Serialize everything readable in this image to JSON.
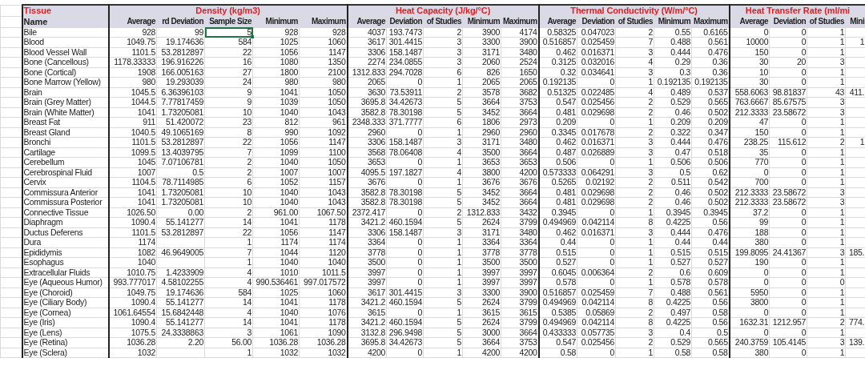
{
  "corner_header": "Tissue",
  "name_header": "Name",
  "groups": [
    {
      "title": "Density (kg/m3)",
      "columns": [
        {
          "label": "Average",
          "selected": false
        },
        {
          "label": "rd Deviation",
          "selected": false
        },
        {
          "label": "Sample Size",
          "selected": true
        },
        {
          "label": "Minimum",
          "selected": false
        },
        {
          "label": "Maximum",
          "selected": false
        }
      ]
    },
    {
      "title": "Heat Capacity (J/kg/°C)",
      "columns": [
        {
          "label": "Average",
          "selected": false
        },
        {
          "label": "Deviation",
          "selected": false
        },
        {
          "label": "of Studies",
          "selected": false
        },
        {
          "label": "Minimum",
          "selected": false
        },
        {
          "label": "Maximum",
          "selected": false
        }
      ]
    },
    {
      "title": "Thermal Conductivity (W/m/°C)",
      "columns": [
        {
          "label": "Average",
          "selected": false
        },
        {
          "label": "Deviation",
          "selected": false
        },
        {
          "label": "of Studies",
          "selected": false
        },
        {
          "label": "Minimum",
          "selected": false
        },
        {
          "label": "Maximum",
          "selected": false
        }
      ]
    },
    {
      "title": "Heat Transfer Rate (ml/mi",
      "columns": [
        {
          "label": "Average",
          "selected": false
        },
        {
          "label": "Deviation",
          "selected": false
        },
        {
          "label": "of Studies",
          "selected": false
        },
        {
          "label": "Mini",
          "selected": false
        }
      ]
    }
  ],
  "rows": [
    {
      "name": "Bile",
      "selected": true,
      "density": {
        "average": "928",
        "deviation": "99",
        "sample_size": "5",
        "minimum": "928",
        "maximum": "928"
      },
      "heat_capacity": [
        "4037",
        "193.7473",
        "2",
        "3900",
        "4174"
      ],
      "thermal_conductivity": [
        "0.58325",
        "0.047023",
        "2",
        "0.55",
        "0.6165"
      ],
      "heat_transfer_rate": [
        "0",
        "0",
        "1"
      ]
    },
    {
      "name": "Blood",
      "selected": false,
      "density": {
        "average": "1049.75",
        "deviation": "19.174636",
        "sample_size": "584",
        "minimum": "1025",
        "maximum": "1060"
      },
      "heat_capacity": [
        "3617",
        "301.4415",
        "3",
        "3300",
        "3900"
      ],
      "thermal_conductivity": [
        "0.516857",
        "0.025459",
        "7",
        "0.488",
        "0.561"
      ],
      "heat_transfer_rate": [
        "10000",
        "0",
        "1",
        "1"
      ]
    },
    {
      "name": "Blood Vessel Wall",
      "selected": false,
      "density": {
        "average": "1101.5",
        "deviation": "53.2812897",
        "sample_size": "22",
        "minimum": "1056",
        "maximum": "1147"
      },
      "heat_capacity": [
        "3306",
        "158.1487",
        "3",
        "3171",
        "3480"
      ],
      "thermal_conductivity": [
        "0.462",
        "0.016371",
        "3",
        "0.444",
        "0.476"
      ],
      "heat_transfer_rate": [
        "150",
        "0",
        "1"
      ]
    },
    {
      "name": "Bone (Cancellous)",
      "selected": false,
      "density": {
        "average": "1178.33333",
        "deviation": "196.916226",
        "sample_size": "16",
        "minimum": "1080",
        "maximum": "1350"
      },
      "heat_capacity": [
        "2274",
        "234.0855",
        "3",
        "2060",
        "2524"
      ],
      "thermal_conductivity": [
        "0.3125",
        "0.032016",
        "4",
        "0.29",
        "0.36"
      ],
      "heat_transfer_rate": [
        "30",
        "20",
        "3"
      ]
    },
    {
      "name": "Bone (Cortical)",
      "selected": false,
      "density": {
        "average": "1908",
        "deviation": "166.005163",
        "sample_size": "27",
        "minimum": "1800",
        "maximum": "2100"
      },
      "heat_capacity": [
        "1312.833",
        "294.7028",
        "6",
        "826",
        "1650"
      ],
      "thermal_conductivity": [
        "0.32",
        "0.034641",
        "3",
        "0.3",
        "0.36"
      ],
      "heat_transfer_rate": [
        "10",
        "0",
        "1"
      ]
    },
    {
      "name": "Bone Marrow (Yellow)",
      "selected": false,
      "density": {
        "average": "980",
        "deviation": "19.293039",
        "sample_size": "24",
        "minimum": "980",
        "maximum": "980"
      },
      "heat_capacity": [
        "2065",
        "0",
        "1",
        "2065",
        "2065"
      ],
      "thermal_conductivity": [
        "0.192135",
        "0",
        "1",
        "0.192135",
        "0.192135"
      ],
      "heat_transfer_rate": [
        "30",
        "0",
        "1"
      ]
    },
    {
      "name": "Brain",
      "selected": false,
      "density": {
        "average": "1045.5",
        "deviation": "6.36396103",
        "sample_size": "9",
        "minimum": "1041",
        "maximum": "1050"
      },
      "heat_capacity": [
        "3630",
        "73.53911",
        "2",
        "3578",
        "3682"
      ],
      "thermal_conductivity": [
        "0.51325",
        "0.022485",
        "4",
        "0.489",
        "0.537"
      ],
      "heat_transfer_rate": [
        "558.6063",
        "98.81837",
        "43",
        "411."
      ]
    },
    {
      "name": "Brain (Grey Matter)",
      "selected": false,
      "density": {
        "average": "1044.5",
        "deviation": "7.77817459",
        "sample_size": "9",
        "minimum": "1039",
        "maximum": "1050"
      },
      "heat_capacity": [
        "3695.8",
        "34.42673",
        "5",
        "3664",
        "3753"
      ],
      "thermal_conductivity": [
        "0.547",
        "0.025456",
        "2",
        "0.529",
        "0.565"
      ],
      "heat_transfer_rate": [
        "763.6667",
        "85.67575",
        "3"
      ]
    },
    {
      "name": "Brain (White Matter)",
      "selected": false,
      "density": {
        "average": "1041",
        "deviation": "1.73205081",
        "sample_size": "10",
        "minimum": "1040",
        "maximum": "1043"
      },
      "heat_capacity": [
        "3582.8",
        "78.30198",
        "5",
        "3452",
        "3664"
      ],
      "thermal_conductivity": [
        "0.481",
        "0.029698",
        "2",
        "0.46",
        "0.502"
      ],
      "heat_transfer_rate": [
        "212.3333",
        "23.58672",
        "3"
      ]
    },
    {
      "name": "Breast Fat",
      "selected": false,
      "density": {
        "average": "911",
        "deviation": "51.420072",
        "sample_size": "23",
        "minimum": "812",
        "maximum": "961"
      },
      "heat_capacity": [
        "2348.333",
        "371.7777",
        "6",
        "1806",
        "2973"
      ],
      "thermal_conductivity": [
        "0.209",
        "0",
        "1",
        "0.209",
        "0.209"
      ],
      "heat_transfer_rate": [
        "47",
        "0",
        "1"
      ]
    },
    {
      "name": "Breast Gland",
      "selected": false,
      "density": {
        "average": "1040.5",
        "deviation": "49.1065169",
        "sample_size": "8",
        "minimum": "990",
        "maximum": "1092"
      },
      "heat_capacity": [
        "2960",
        "0",
        "1",
        "2960",
        "2960"
      ],
      "thermal_conductivity": [
        "0.3345",
        "0.017678",
        "2",
        "0.322",
        "0.347"
      ],
      "heat_transfer_rate": [
        "150",
        "0",
        "1"
      ]
    },
    {
      "name": "Bronchi",
      "selected": false,
      "density": {
        "average": "1101.5",
        "deviation": "53.2812897",
        "sample_size": "22",
        "minimum": "1056",
        "maximum": "1147"
      },
      "heat_capacity": [
        "3306",
        "158.1487",
        "3",
        "3171",
        "3480"
      ],
      "thermal_conductivity": [
        "0.462",
        "0.016371",
        "3",
        "0.444",
        "0.476"
      ],
      "heat_transfer_rate": [
        "238.25",
        "115.612",
        "2",
        "1"
      ]
    },
    {
      "name": "Cartilage",
      "selected": false,
      "density": {
        "average": "1099.5",
        "deviation": "13.4039795",
        "sample_size": "7",
        "minimum": "1099",
        "maximum": "1100"
      },
      "heat_capacity": [
        "3568",
        "78.06408",
        "4",
        "3500",
        "3664"
      ],
      "thermal_conductivity": [
        "0.487",
        "0.026889",
        "3",
        "0.47",
        "0.518"
      ],
      "heat_transfer_rate": [
        "35",
        "0",
        "1"
      ]
    },
    {
      "name": "Cerebellum",
      "selected": false,
      "density": {
        "average": "1045",
        "deviation": "7.07106781",
        "sample_size": "2",
        "minimum": "1040",
        "maximum": "1050"
      },
      "heat_capacity": [
        "3653",
        "0",
        "1",
        "3653",
        "3653"
      ],
      "thermal_conductivity": [
        "0.506",
        "0",
        "1",
        "0.506",
        "0.506"
      ],
      "heat_transfer_rate": [
        "770",
        "0",
        "1"
      ]
    },
    {
      "name": "Cerebrospinal Fluid",
      "selected": false,
      "density": {
        "average": "1007",
        "deviation": "0.5",
        "sample_size": "2",
        "minimum": "1007",
        "maximum": "1007"
      },
      "heat_capacity": [
        "4095.5",
        "197.1827",
        "4",
        "3800",
        "4200"
      ],
      "thermal_conductivity": [
        "0.573333",
        "0.064291",
        "3",
        "0.5",
        "0.62"
      ],
      "heat_transfer_rate": [
        "0",
        "0",
        "1"
      ]
    },
    {
      "name": "Cervix",
      "selected": false,
      "density": {
        "average": "1104.5",
        "deviation": "78.7114985",
        "sample_size": "6",
        "minimum": "1052",
        "maximum": "1157"
      },
      "heat_capacity": [
        "3676",
        "0",
        "1",
        "3676",
        "3676"
      ],
      "thermal_conductivity": [
        "0.5265",
        "0.02192",
        "2",
        "0.511",
        "0.542"
      ],
      "heat_transfer_rate": [
        "700",
        "0",
        "1"
      ]
    },
    {
      "name": "Commissura Anterior",
      "selected": false,
      "density": {
        "average": "1041",
        "deviation": "1.73205081",
        "sample_size": "10",
        "minimum": "1040",
        "maximum": "1043"
      },
      "heat_capacity": [
        "3582.8",
        "78.30198",
        "5",
        "3452",
        "3664"
      ],
      "thermal_conductivity": [
        "0.481",
        "0.029698",
        "2",
        "0.46",
        "0.502"
      ],
      "heat_transfer_rate": [
        "212.3333",
        "23.58672",
        "3"
      ]
    },
    {
      "name": "Commissura Posterior",
      "selected": false,
      "density": {
        "average": "1041",
        "deviation": "1.73205081",
        "sample_size": "10",
        "minimum": "1040",
        "maximum": "1043"
      },
      "heat_capacity": [
        "3582.8",
        "78.30198",
        "5",
        "3452",
        "3664"
      ],
      "thermal_conductivity": [
        "0.481",
        "0.029698",
        "2",
        "0.46",
        "0.502"
      ],
      "heat_transfer_rate": [
        "212.3333",
        "23.58672",
        "3"
      ]
    },
    {
      "name": "Connective Tissue",
      "selected": false,
      "density": {
        "average": "1026.50",
        "deviation": "0.00",
        "sample_size": "2",
        "minimum": "961.00",
        "maximum": "1067.50"
      },
      "heat_capacity": [
        "2372.417",
        "0",
        "2",
        "1312.833",
        "3432"
      ],
      "thermal_conductivity": [
        "0.3945",
        "0",
        "1",
        "0.3945",
        "0.3945"
      ],
      "heat_transfer_rate": [
        "37.2",
        "0",
        "1"
      ]
    },
    {
      "name": "Diaphragm",
      "selected": false,
      "density": {
        "average": "1090.4",
        "deviation": "55.141277",
        "sample_size": "14",
        "minimum": "1041",
        "maximum": "1178"
      },
      "heat_capacity": [
        "3421.2",
        "460.1594",
        "5",
        "2624",
        "3799"
      ],
      "thermal_conductivity": [
        "0.494969",
        "0.042114",
        "8",
        "0.4225",
        "0.56"
      ],
      "heat_transfer_rate": [
        "99",
        "0",
        "1"
      ]
    },
    {
      "name": "Ductus Deferens",
      "selected": false,
      "density": {
        "average": "1101.5",
        "deviation": "53.2812897",
        "sample_size": "22",
        "minimum": "1056",
        "maximum": "1147"
      },
      "heat_capacity": [
        "3306",
        "158.1487",
        "3",
        "3171",
        "3480"
      ],
      "thermal_conductivity": [
        "0.462",
        "0.016371",
        "3",
        "0.444",
        "0.476"
      ],
      "heat_transfer_rate": [
        "188",
        "0",
        "1"
      ]
    },
    {
      "name": "Dura",
      "selected": false,
      "density": {
        "average": "1174",
        "sample_size": "1",
        "minimum": "1174",
        "maximum": "1174"
      },
      "heat_capacity": [
        "3364",
        "0",
        "1",
        "3364",
        "3364"
      ],
      "thermal_conductivity": [
        "0.44",
        "0",
        "1",
        "0.44",
        "0.44"
      ],
      "heat_transfer_rate": [
        "380",
        "0",
        "1"
      ]
    },
    {
      "name": "Epididymis",
      "selected": false,
      "density": {
        "average": "1082",
        "deviation": "46.9649005",
        "sample_size": "7",
        "minimum": "1044",
        "maximum": "1120"
      },
      "heat_capacity": [
        "3778",
        "0",
        "1",
        "3778",
        "3778"
      ],
      "thermal_conductivity": [
        "0.515",
        "0",
        "1",
        "0.515",
        "0.515"
      ],
      "heat_transfer_rate": [
        "199.8095",
        "24.41367",
        "3",
        "185."
      ]
    },
    {
      "name": "Esophagus",
      "selected": false,
      "density": {
        "average": "1040",
        "sample_size": "1",
        "minimum": "1040",
        "maximum": "1040"
      },
      "heat_capacity": [
        "3500",
        "0",
        "1",
        "3500",
        "3500"
      ],
      "thermal_conductivity": [
        "0.527",
        "0",
        "1",
        "0.527",
        "0.527"
      ],
      "heat_transfer_rate": [
        "190",
        "0",
        "1"
      ]
    },
    {
      "name": "Extracellular Fluids",
      "selected": false,
      "density": {
        "average": "1010.75",
        "deviation": "1.4233909",
        "sample_size": "4",
        "minimum": "1010",
        "maximum": "1011.5"
      },
      "heat_capacity": [
        "3997",
        "0",
        "1",
        "3997",
        "3997"
      ],
      "thermal_conductivity": [
        "0.6045",
        "0.006364",
        "2",
        "0.6",
        "0.609"
      ],
      "heat_transfer_rate": [
        "0",
        "0",
        "1"
      ]
    },
    {
      "name": "Eye (Aqueous Humor)",
      "selected": false,
      "density": {
        "average": "993.777017",
        "deviation": "4.58102255",
        "sample_size": "4",
        "minimum": "990.536461",
        "maximum": "997.017572"
      },
      "heat_capacity": [
        "3997",
        "0",
        "1",
        "3997",
        "3997"
      ],
      "thermal_conductivity": [
        "0.578",
        "0",
        "1",
        "0.578",
        "0.578"
      ],
      "heat_transfer_rate": [
        "0",
        "0",
        "0"
      ]
    },
    {
      "name": "Eye (Choroid)",
      "selected": false,
      "density": {
        "average": "1049.75",
        "deviation": "19.174636",
        "sample_size": "584",
        "minimum": "1025",
        "maximum": "1060"
      },
      "heat_capacity": [
        "3617",
        "301.4415",
        "3",
        "3300",
        "3900"
      ],
      "thermal_conductivity": [
        "0.516857",
        "0.025459",
        "7",
        "0.488",
        "0.561"
      ],
      "heat_transfer_rate": [
        "5950",
        "0",
        "1"
      ]
    },
    {
      "name": "Eye (Ciliary Body)",
      "selected": false,
      "density": {
        "average": "1090.4",
        "deviation": "55.141277",
        "sample_size": "14",
        "minimum": "1041",
        "maximum": "1178"
      },
      "heat_capacity": [
        "3421.2",
        "460.1594",
        "5",
        "2624",
        "3799"
      ],
      "thermal_conductivity": [
        "0.494969",
        "0.042114",
        "8",
        "0.4225",
        "0.56"
      ],
      "heat_transfer_rate": [
        "3800",
        "0",
        "1"
      ]
    },
    {
      "name": "Eye (Cornea)",
      "selected": false,
      "density": {
        "average": "1061.64554",
        "deviation": "15.6842448",
        "sample_size": "4",
        "minimum": "1040",
        "maximum": "1076"
      },
      "heat_capacity": [
        "3615",
        "0",
        "1",
        "3615",
        "3615"
      ],
      "thermal_conductivity": [
        "0.5385",
        "0.05869",
        "2",
        "0.497",
        "0.58"
      ],
      "heat_transfer_rate": [
        "0",
        "0",
        "1"
      ]
    },
    {
      "name": "Eye (Iris)",
      "selected": false,
      "density": {
        "average": "1090.4",
        "deviation": "55.141277",
        "sample_size": "14",
        "minimum": "1041",
        "maximum": "1178"
      },
      "heat_capacity": [
        "3421.2",
        "460.1594",
        "5",
        "2624",
        "3799"
      ],
      "thermal_conductivity": [
        "0.494969",
        "0.042114",
        "8",
        "0.4225",
        "0.56"
      ],
      "heat_transfer_rate": [
        "1632.31",
        "1212.957",
        "2",
        "774."
      ]
    },
    {
      "name": "Eye (Lens)",
      "selected": false,
      "density": {
        "average": "1075.5",
        "deviation": "24.3338863",
        "sample_size": "3",
        "minimum": "1061",
        "maximum": "1090"
      },
      "heat_capacity": [
        "3132.8",
        "296.9498",
        "5",
        "3000",
        "3664"
      ],
      "thermal_conductivity": [
        "0.433333",
        "0.057735",
        "3",
        "0.4",
        "0.5"
      ],
      "heat_transfer_rate": [
        "0",
        "0",
        "1"
      ]
    },
    {
      "name": "Eye (Retina)",
      "selected": false,
      "density": {
        "average": "1036.28",
        "deviation": "2.20",
        "sample_size": "56.00",
        "minimum": "1036.28",
        "maximum": "1036.28"
      },
      "heat_capacity": [
        "3695.8",
        "34.42673",
        "5",
        "3664",
        "3753"
      ],
      "thermal_conductivity": [
        "0.547",
        "0.025456",
        "2",
        "0.529",
        "0.565"
      ],
      "heat_transfer_rate": [
        "240.3759",
        "105.4145",
        "3",
        "139."
      ]
    },
    {
      "name": "Eye (Sclera)",
      "selected": false,
      "density": {
        "average": "1032",
        "sample_size": "1",
        "minimum": "1032",
        "maximum": "1032"
      },
      "heat_capacity": [
        "4200",
        "0",
        "1",
        "4200",
        "4200"
      ],
      "thermal_conductivity": [
        "0.58",
        "0",
        "1",
        "0.58",
        "0.58"
      ],
      "heat_transfer_rate": [
        "380",
        "0",
        "1"
      ]
    }
  ]
}
